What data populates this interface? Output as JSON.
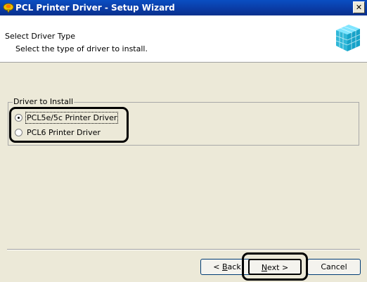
{
  "window": {
    "title": "PCL Printer Driver - Setup Wizard",
    "close_glyph": "✕"
  },
  "header": {
    "title": "Select Driver Type",
    "subtitle": "Select the type of driver to install.",
    "logo_icon": "setup-cube-logo"
  },
  "group": {
    "legend": "Driver to Install",
    "options": [
      {
        "label": "PCL5e/5c Printer Driver",
        "selected": true
      },
      {
        "label": "PCL6 Printer Driver",
        "selected": false
      }
    ]
  },
  "buttons": {
    "back_prefix": "< ",
    "back_underlined": "B",
    "back_rest": "ack",
    "next_underlined": "N",
    "next_rest": "ext >",
    "cancel": "Cancel"
  },
  "colors": {
    "titlebar": "#0a3aa3",
    "dialog_bg": "#ece9d8",
    "button_border": "#003c74"
  }
}
